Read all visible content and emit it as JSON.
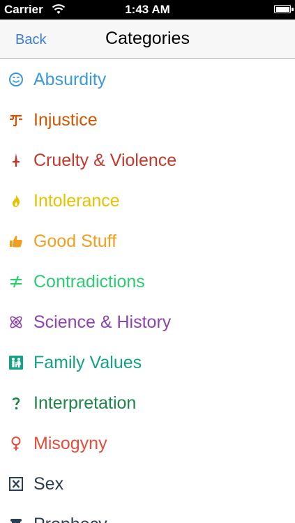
{
  "status_bar": {
    "carrier": "Carrier",
    "time": "1:43 AM",
    "wifi_icon": "wifi-icon",
    "battery_icon": "battery-icon"
  },
  "nav_bar": {
    "back_label": "Back",
    "title": "Categories"
  },
  "categories": [
    {
      "label": "Absurdity",
      "icon": "smiley-icon",
      "glyph": "☺",
      "color": "#3b9ad9"
    },
    {
      "label": "Injustice",
      "icon": "injustice-icon",
      "glyph": "⚖",
      "color": "#d35400"
    },
    {
      "label": "Cruelty & Violence",
      "icon": "dagger-icon",
      "glyph": "🗡",
      "color": "#c0392b"
    },
    {
      "label": "Intolerance",
      "icon": "flame-icon",
      "glyph": "🔥",
      "color": "#e6c200"
    },
    {
      "label": "Good Stuff",
      "icon": "thumbs-up-icon",
      "glyph": "👍",
      "color": "#f0a01e"
    },
    {
      "label": "Contradictions",
      "icon": "not-equal-icon",
      "glyph": "≠",
      "color": "#2ecc71"
    },
    {
      "label": "Science & History",
      "icon": "atom-icon",
      "glyph": "⚛",
      "color": "#8e44ad"
    },
    {
      "label": "Family Values",
      "icon": "family-icon",
      "glyph": "👪",
      "color": "#16a085"
    },
    {
      "label": "Interpretation",
      "icon": "question-icon",
      "glyph": "?",
      "color": "#1e8449"
    },
    {
      "label": "Misogyny",
      "icon": "female-symbol-icon",
      "glyph": "♀",
      "color": "#e74c3c"
    },
    {
      "label": "Sex",
      "icon": "x-rated-icon",
      "glyph": "☒",
      "color": "#2c3e50"
    },
    {
      "label": "Prophecy",
      "icon": "scroll-icon",
      "glyph": "📜",
      "color": "#2c3e50"
    }
  ]
}
